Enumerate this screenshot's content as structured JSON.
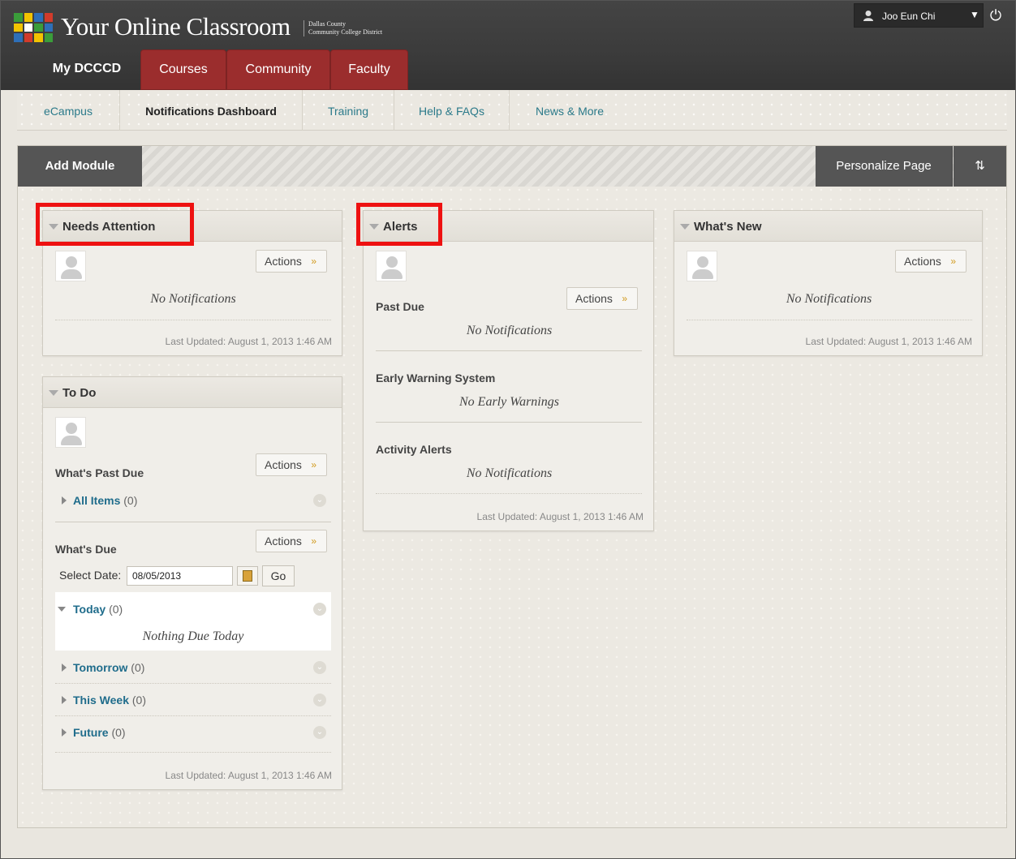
{
  "header": {
    "site_title": "Your Online Classroom",
    "site_sub_line1": "Dallas County",
    "site_sub_line2": "Community College District",
    "user_name": "Joo Eun Chi",
    "tabs": [
      {
        "label": "My DCCCD"
      },
      {
        "label": "Courses"
      },
      {
        "label": "Community"
      },
      {
        "label": "Faculty"
      }
    ]
  },
  "subnav": {
    "items": [
      {
        "label": "eCampus"
      },
      {
        "label": "Notifications Dashboard"
      },
      {
        "label": "Training"
      },
      {
        "label": "Help & FAQs"
      },
      {
        "label": "News & More"
      }
    ]
  },
  "toolbar": {
    "add_module": "Add Module",
    "personalize": "Personalize Page",
    "sort_icon": "⇅"
  },
  "modules": {
    "needs_attention": {
      "title": "Needs Attention",
      "actions": "Actions",
      "message": "No Notifications",
      "last_updated": "Last Updated: August 1, 2013 1:46 AM"
    },
    "alerts": {
      "title": "Alerts",
      "actions": "Actions",
      "past_due_label": "Past Due",
      "past_due_message": "No Notifications",
      "early_warning_label": "Early Warning System",
      "early_warning_message": "No Early Warnings",
      "activity_label": "Activity Alerts",
      "activity_message": "No Notifications",
      "last_updated": "Last Updated: August 1, 2013 1:46 AM"
    },
    "whats_new": {
      "title": "What's New",
      "actions": "Actions",
      "message": "No Notifications",
      "last_updated": "Last Updated: August 1, 2013 1:46 AM"
    },
    "todo": {
      "title": "To Do",
      "past_due_label": "What's Past Due",
      "actions": "Actions",
      "all_items": {
        "label": "All Items",
        "count": "(0)"
      },
      "whats_due_label": "What's Due",
      "actions2": "Actions",
      "select_date_label": "Select Date:",
      "date_value": "08/05/2013",
      "go_label": "Go",
      "today": {
        "label": "Today",
        "count": "(0)"
      },
      "nothing_due": "Nothing Due Today",
      "tomorrow": {
        "label": "Tomorrow",
        "count": "(0)"
      },
      "this_week": {
        "label": "This Week",
        "count": "(0)"
      },
      "future": {
        "label": "Future",
        "count": "(0)"
      },
      "last_updated": "Last Updated: August 1, 2013 1:46 AM"
    }
  },
  "colors": {
    "header_bg": "#3b3b3b",
    "tab_red": "#9b2d2d",
    "link_teal": "#2b7a8a",
    "highlight_red": "#ee1111",
    "actions_chevron": "#d19a1d"
  }
}
